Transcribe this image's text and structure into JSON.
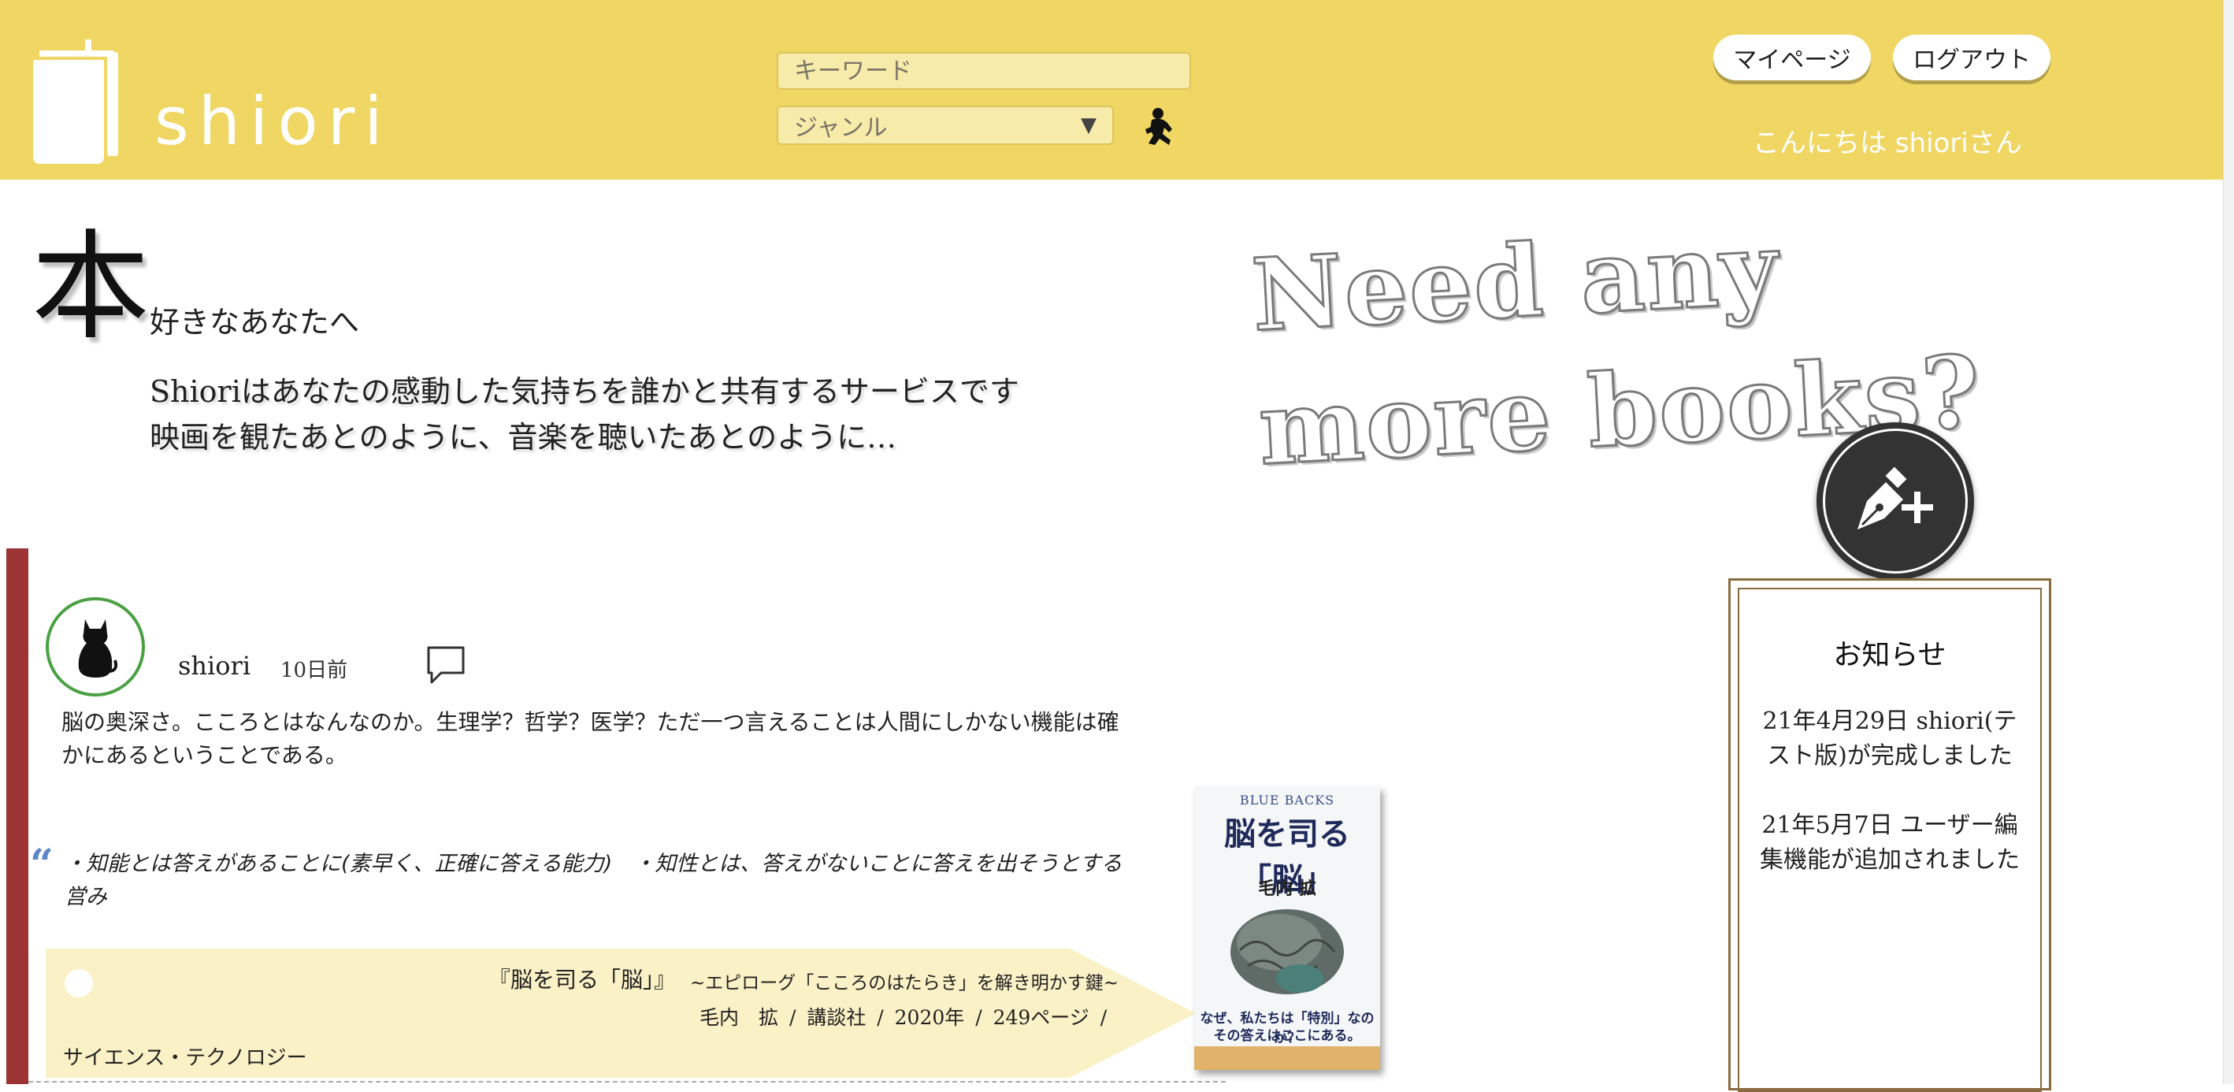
{
  "header": {
    "logo_text": "shiori",
    "search": {
      "placeholder": "キーワード",
      "genre_label": "ジャンル"
    },
    "mypage_label": "マイページ",
    "logout_label": "ログアウト",
    "greeting": "こんにちは shioriさん"
  },
  "hero": {
    "kanji": "本",
    "subtitle": "好きなあなたへ",
    "desc_line1": "Shioriはあなたの感動した気持ちを誰かと共有するサービスです",
    "desc_line2": "映画を観たあとのように、音楽を聴いたあとのように…",
    "tagline": "Need any more books?"
  },
  "post": {
    "user": "shiori",
    "time": "10日前",
    "body": "脳の奥深さ。こころとはなんなのか。生理学？哲学？医学？ただ一つ言えることは人間にしかない機能は確かにあるということである。",
    "quote_mark": "“",
    "quote": "・知能とは答えがあることに(素早く、正確に答える能力)　・知性とは、答えがないことに答えを出そうとする営み",
    "book": {
      "title": "『脳を司る「脳」』",
      "subtitle": "~エピローグ「こころのはたらき」を解き明かす鍵~",
      "meta": "毛内　拡 / 講談社 / 2020年 / 249ページ /",
      "genre": "サイエンス・テクノロジー",
      "cover": {
        "series": "BLUE BACKS",
        "title": "脳を司る「脳」",
        "author": "毛内 拡",
        "caption_line1": "なぜ、私たちは「特別」なのか？",
        "caption_line2": "その答えはここにある。"
      }
    }
  },
  "notice": {
    "title": "お知らせ",
    "items": [
      "21年4月29日 shiori(テスト版)が完成しました",
      "21年5月7日 ユーザー編集機能が追加されました"
    ]
  },
  "icons": {
    "logo": "book-bookmark-icon",
    "search": "crouching-figure-icon",
    "post": "pen-plus-icon",
    "comment": "speech-bubble-icon",
    "avatar": "cat-icon"
  },
  "colors": {
    "header_bg": "#f0d662",
    "post_stripe": "#9c3334",
    "avatar_ring": "#4aa043",
    "quote_mark": "#5a86c8",
    "notice_border": "#8a6a3e",
    "banner_bg": "#fbf1c6"
  }
}
